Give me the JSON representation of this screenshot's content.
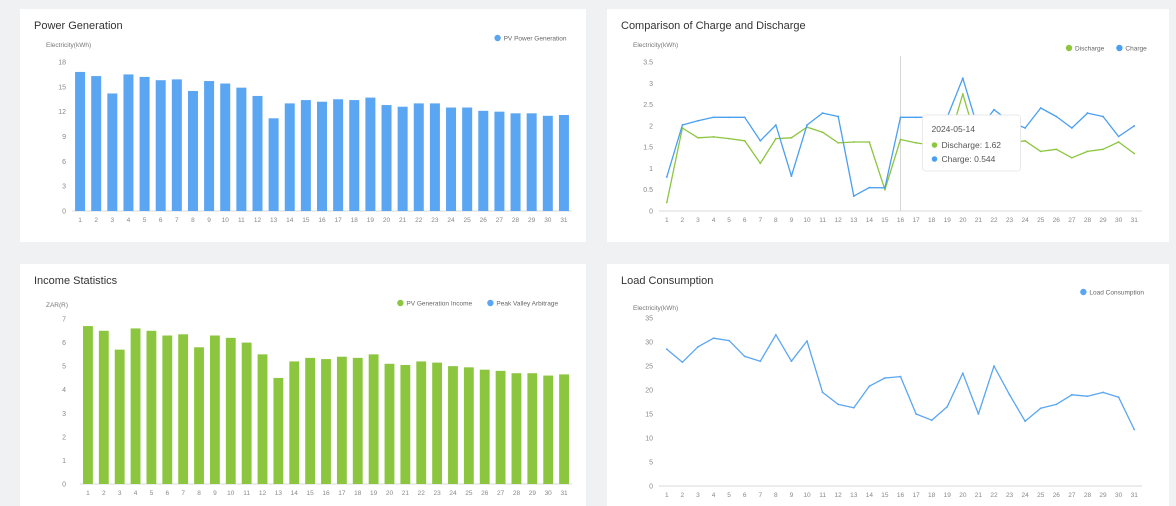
{
  "charts": [
    {
      "card": "card-power",
      "title": "Power Generation",
      "chart_data": {
        "type": "bar",
        "title": "Power Generation",
        "ylabel": "Electricity(kWh)",
        "xlabel": "",
        "ylim": [
          0,
          18
        ],
        "yticks": [
          0,
          3,
          6,
          9,
          12,
          15,
          18
        ],
        "categories": [
          "1",
          "2",
          "3",
          "4",
          "5",
          "6",
          "7",
          "8",
          "9",
          "10",
          "11",
          "12",
          "13",
          "14",
          "15",
          "16",
          "17",
          "18",
          "19",
          "20",
          "21",
          "22",
          "23",
          "24",
          "25",
          "26",
          "27",
          "28",
          "29",
          "30",
          "31"
        ],
        "series": [
          {
            "name": "PV Power Generation",
            "color": "#5ba6f2",
            "values": [
              16.8,
              16.3,
              14.2,
              16.5,
              16.2,
              15.8,
              15.9,
              14.5,
              15.7,
              15.4,
              14.9,
              13.9,
              11.2,
              13.0,
              13.4,
              13.2,
              13.5,
              13.4,
              13.7,
              12.8,
              12.6,
              13.0,
              13.0,
              12.5,
              12.5,
              12.1,
              12.0,
              11.8,
              11.8,
              11.5,
              11.6
            ]
          }
        ],
        "legend": "top-right",
        "grid": false
      }
    },
    {
      "card": "card-charge",
      "title": "Comparison of Charge and Discharge",
      "chart_data": {
        "type": "line",
        "title": "Comparison of Charge and Discharge",
        "ylabel": "Electricity(kWh)",
        "xlabel": "",
        "ylim": [
          0,
          3.5
        ],
        "yticks": [
          0,
          0.5,
          1,
          1.5,
          2,
          2.5,
          3,
          3.5
        ],
        "categories": [
          "1",
          "2",
          "3",
          "4",
          "5",
          "6",
          "7",
          "8",
          "9",
          "10",
          "11",
          "12",
          "13",
          "14",
          "15",
          "16",
          "17",
          "18",
          "19",
          "20",
          "21",
          "22",
          "23",
          "24",
          "25",
          "26",
          "27",
          "28",
          "29",
          "30",
          "31"
        ],
        "series": [
          {
            "name": "Discharge",
            "color": "#8cc63f",
            "values": [
              0.2,
              1.95,
              1.72,
              1.74,
              1.7,
              1.65,
              1.12,
              1.7,
              1.72,
              1.97,
              1.85,
              1.6,
              1.62,
              1.62,
              0.5,
              1.68,
              1.6,
              1.55,
              1.5,
              2.75,
              1.5,
              1.8,
              1.6,
              1.65,
              1.4,
              1.45,
              1.25,
              1.4,
              1.45,
              1.62,
              1.35
            ]
          },
          {
            "name": "Charge",
            "color": "#4a9ff0",
            "values": [
              0.8,
              2.02,
              2.12,
              2.2,
              2.2,
              2.2,
              1.65,
              2.02,
              0.82,
              2.02,
              2.3,
              2.22,
              0.35,
              0.55,
              0.544,
              2.2,
              2.2,
              2.2,
              2.2,
              3.12,
              1.9,
              2.38,
              2.1,
              1.95,
              2.42,
              2.22,
              1.95,
              2.3,
              2.22,
              1.75,
              2.0
            ]
          }
        ],
        "legend": "top-right",
        "grid": false,
        "tooltip": {
          "index": 15,
          "date": "2024-05-14",
          "lines": [
            {
              "label": "Discharge: 1.62",
              "color": "#8cc63f"
            },
            {
              "label": "Charge: 0.544",
              "color": "#4a9ff0"
            }
          ]
        }
      }
    },
    {
      "card": "card-income",
      "title": "Income Statistics",
      "chart_data": {
        "type": "bar",
        "title": "Income Statistics",
        "ylabel": "ZAR(R)",
        "xlabel": "",
        "ylim": [
          0,
          7
        ],
        "yticks": [
          0,
          1,
          2,
          3,
          4,
          5,
          6,
          7
        ],
        "categories": [
          "1",
          "2",
          "3",
          "4",
          "5",
          "6",
          "7",
          "8",
          "9",
          "10",
          "11",
          "12",
          "13",
          "14",
          "15",
          "16",
          "17",
          "18",
          "19",
          "20",
          "21",
          "22",
          "23",
          "24",
          "25",
          "26",
          "27",
          "28",
          "29",
          "30",
          "31"
        ],
        "series": [
          {
            "name": "PV Generation Income",
            "color": "#8cc63f",
            "values": [
              6.7,
              6.5,
              5.7,
              6.6,
              6.5,
              6.3,
              6.35,
              5.8,
              6.3,
              6.2,
              6.0,
              5.5,
              4.5,
              5.2,
              5.35,
              5.3,
              5.4,
              5.35,
              5.5,
              5.1,
              5.05,
              5.2,
              5.15,
              5.0,
              4.95,
              4.85,
              4.8,
              4.7,
              4.7,
              4.6,
              4.65
            ]
          },
          {
            "name": "Peak Valley Arbitrage",
            "color": "#5ba6f2",
            "values": []
          }
        ],
        "legend": "top-right",
        "grid": false
      }
    },
    {
      "card": "card-load",
      "title": "Load Consumption",
      "chart_data": {
        "type": "line",
        "title": "Load Consumption",
        "ylabel": "Electricity(kWh)",
        "xlabel": "",
        "ylim": [
          0,
          35
        ],
        "yticks": [
          0,
          5,
          10,
          15,
          20,
          25,
          30,
          35
        ],
        "categories": [
          "1",
          "2",
          "3",
          "4",
          "5",
          "6",
          "7",
          "8",
          "9",
          "10",
          "11",
          "12",
          "13",
          "14",
          "15",
          "16",
          "17",
          "18",
          "19",
          "20",
          "21",
          "22",
          "23",
          "24",
          "25",
          "26",
          "27",
          "28",
          "29",
          "30",
          "31"
        ],
        "series": [
          {
            "name": "Load Consumption",
            "color": "#5ba6f2",
            "values": [
              28.5,
              25.8,
              29,
              30.8,
              30.3,
              27,
              26,
              31.5,
              26,
              30.2,
              19.5,
              17,
              16.3,
              20.8,
              22.5,
              22.8,
              15,
              13.7,
              16.5,
              23.5,
              15,
              25,
              19,
              13.5,
              16.2,
              17,
              19,
              18.7,
              19.5,
              18.5,
              11.8
            ]
          }
        ],
        "legend": "top-right",
        "grid": false
      }
    }
  ]
}
